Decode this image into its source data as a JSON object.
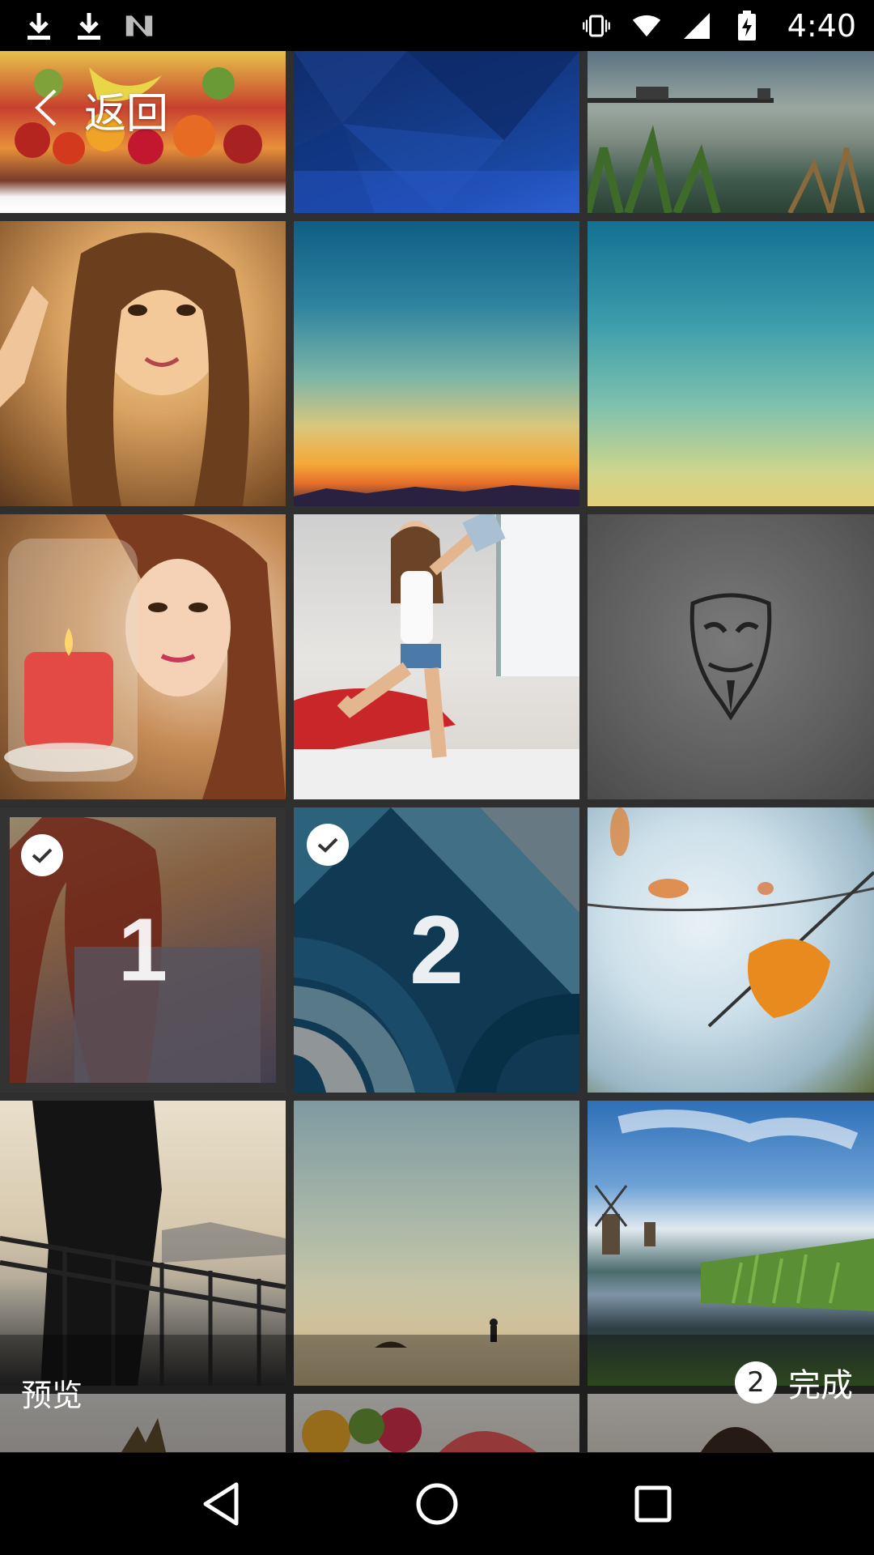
{
  "status_bar": {
    "left_icons": [
      "download-icon",
      "download-icon",
      "n-logo-icon"
    ],
    "right_icons": [
      "vibrate-icon",
      "wifi-icon",
      "signal-icon",
      "battery-charging-icon"
    ],
    "time": "4:40"
  },
  "header": {
    "back_label": "返回",
    "back_icon": "chevron-left-icon"
  },
  "grid": {
    "tiles": [
      {
        "name": "photo-fruits"
      },
      {
        "name": "photo-blue-polygons"
      },
      {
        "name": "photo-lake-pier"
      },
      {
        "name": "photo-woman-selfie"
      },
      {
        "name": "photo-sunset-gradient"
      },
      {
        "name": "photo-teal-gradient"
      },
      {
        "name": "photo-woman-candle"
      },
      {
        "name": "photo-woman-bedroom"
      },
      {
        "name": "photo-mask-gray"
      },
      {
        "name": "photo-redhead-woman",
        "selected": true,
        "order": "1"
      },
      {
        "name": "photo-blue-arcs",
        "selected": true,
        "order": "2"
      },
      {
        "name": "photo-autumn-leaf"
      },
      {
        "name": "photo-couple-silhouette"
      },
      {
        "name": "photo-desert-figure"
      },
      {
        "name": "photo-windmill-landscape"
      },
      {
        "name": "photo-pineapple"
      },
      {
        "name": "photo-fruit-bowl"
      },
      {
        "name": "photo-woman-portrait"
      }
    ]
  },
  "action_bar": {
    "preview_label": "预览",
    "selected_count": "2",
    "done_label": "完成"
  },
  "nav_bar": {
    "back": "nav-back-icon",
    "home": "nav-home-icon",
    "recents": "nav-recents-icon"
  }
}
